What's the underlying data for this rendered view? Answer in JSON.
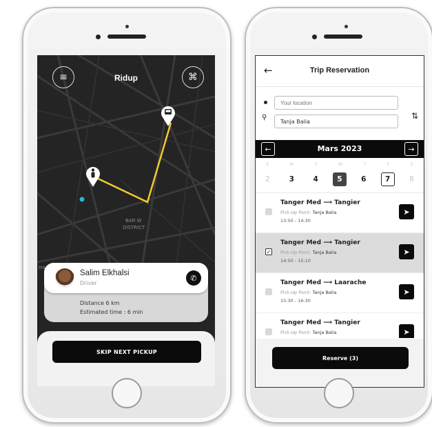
{
  "map_screen": {
    "title": "Ridup",
    "street_labels": [
      "BAR W",
      "DISTRICT",
      "rrace"
    ],
    "driver": {
      "name": "Salim Elkhalsi",
      "role": "Driver"
    },
    "distance": "Distance 6 km",
    "estimated_time": "Estimated time : 6 min",
    "skip_button": "SKIP NEXT PICKUP",
    "route_color": "#f1cd2b",
    "icons": [
      "menu-icon",
      "scan-icon",
      "bus-pin-icon",
      "person-pin-icon",
      "phone-icon"
    ]
  },
  "reservation_screen": {
    "title": "Trip Reservation",
    "origin_placeholder": "Your location",
    "destination_value": "Tanja Balia",
    "month": "Mars 2023",
    "weekdays": [
      "S",
      "M",
      "T",
      "W",
      "T",
      "F",
      "S"
    ],
    "days": [
      {
        "num": "2",
        "state": "muted"
      },
      {
        "num": "3",
        "state": "normal"
      },
      {
        "num": "4",
        "state": "normal"
      },
      {
        "num": "5",
        "state": "selected"
      },
      {
        "num": "6",
        "state": "normal"
      },
      {
        "num": "7",
        "state": "today"
      },
      {
        "num": "8",
        "state": "muted"
      }
    ],
    "trips": [
      {
        "from": "Tanger Med",
        "to": "Tangier",
        "pickup_label": "Pick-Up Point:",
        "pickup": "Tanja Balia",
        "time": "13:50 - 14:30",
        "checked": false
      },
      {
        "from": "Tanger Med",
        "to": "Tangier",
        "pickup_label": "Pick-Up Point:",
        "pickup": "Tanja Balia",
        "time": "14:50 - 15:10",
        "checked": true
      },
      {
        "from": "Tanger Med",
        "to": "Laarache",
        "pickup_label": "Pick-Up Point:",
        "pickup": "Tanja Balia",
        "time": "15:30 - 16:30",
        "checked": false
      },
      {
        "from": "Tanger Med",
        "to": "Tangier",
        "pickup_label": "Pick-Up Point:",
        "pickup": "Tanja Balia",
        "time": "",
        "checked": false
      }
    ],
    "reserve_button": "Reserve (3)"
  }
}
